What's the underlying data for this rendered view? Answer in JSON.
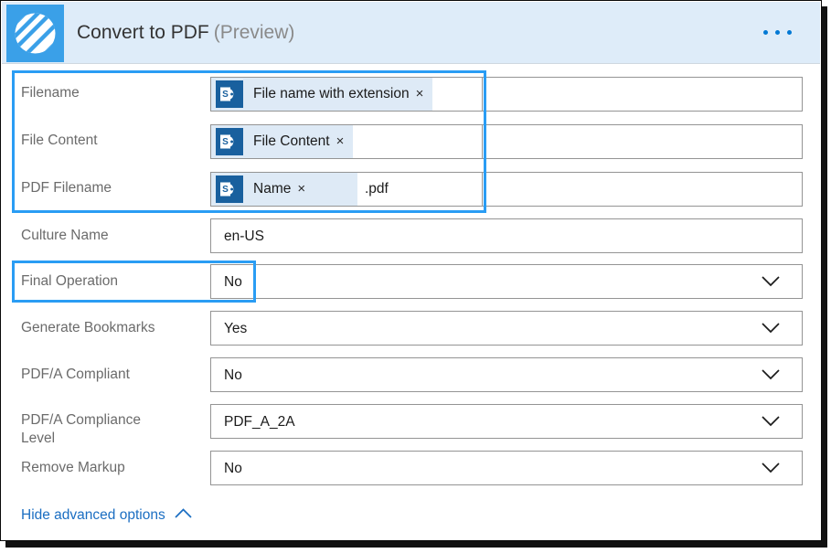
{
  "header": {
    "title": "Convert to PDF",
    "subtitle": "(Preview)",
    "app_icon_name": "striped-circle-icon",
    "overflow_menu_label": "..."
  },
  "colors": {
    "header_bg": "#deecf9",
    "app_icon_bg": "#3aa0e8",
    "accent_blue": "#0078d4",
    "highlight_blue": "#2a9df4",
    "chip_bg": "#deeaf6",
    "sharepoint_icon_bg": "#19609e",
    "link_blue": "#1b6ec2",
    "label_gray": "#6b6b6b",
    "field_border": "#949494"
  },
  "fields": [
    {
      "label": "Filename",
      "type": "token",
      "token": {
        "source": "SharePoint",
        "text": "File name with extension",
        "remove_label": "×"
      },
      "suffix": "",
      "highlighted": true
    },
    {
      "label": "File Content",
      "type": "token",
      "token": {
        "source": "SharePoint",
        "text": "File Content",
        "remove_label": "×"
      },
      "suffix": "",
      "highlighted": true
    },
    {
      "label": "PDF Filename",
      "type": "token",
      "token": {
        "source": "SharePoint",
        "text": "Name",
        "remove_label": "×"
      },
      "suffix": ".pdf",
      "highlighted": true
    },
    {
      "label": "Culture Name",
      "type": "text",
      "value": "en-US",
      "highlighted": false
    },
    {
      "label": "Final Operation",
      "type": "select",
      "value": "No",
      "highlighted": true
    },
    {
      "label": "Generate Bookmarks",
      "type": "select",
      "value": "Yes",
      "highlighted": false
    },
    {
      "label": "PDF/A Compliant",
      "type": "select",
      "value": "No",
      "highlighted": false
    },
    {
      "label": "PDF/A Compliance\nLevel",
      "type": "select",
      "value": "PDF_A_2A",
      "highlighted": false
    },
    {
      "label": "Remove Markup",
      "type": "select",
      "value": "No",
      "highlighted": false
    }
  ],
  "footer": {
    "advanced_options_label": "Hide advanced options",
    "caret_icon": "chevron-up-icon"
  }
}
